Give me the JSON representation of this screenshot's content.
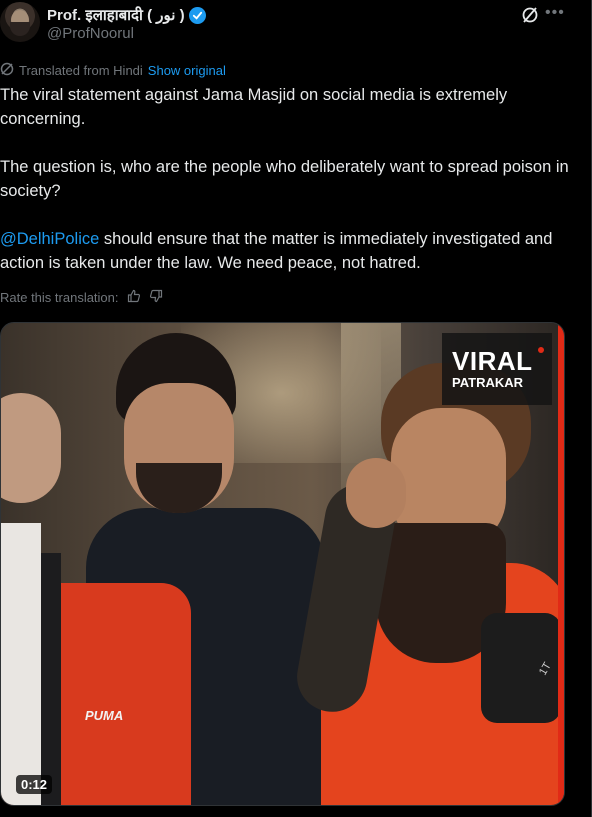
{
  "author": {
    "display_name": "Prof. इलाहाबादी ( نور )",
    "handle": "@ProfNoorul"
  },
  "translation": {
    "label": "Translated from Hindi",
    "show_original": "Show original",
    "rate_label": "Rate this translation:"
  },
  "tweet": {
    "para1": "The viral statement against Jama Masjid on social media is extremely concerning.",
    "para2": "The question is, who are the people who deliberately want to spread poison in society?",
    "mention": "@DelhiPolice",
    "para3_rest": " should ensure that the matter is immediately investigated and action is taken under the law. We need peace, not hatred."
  },
  "video": {
    "logo_line1": "VIRAL",
    "logo_line2": "PATRAKAR",
    "duration": "0:12",
    "jacket_text": "PUMA",
    "mic_text": "1T"
  },
  "colors": {
    "accent": "#1d9bf0",
    "muted": "#71767b",
    "text": "#e7e9ea",
    "background": "#000000"
  },
  "icons": [
    "verified-badge-icon",
    "grok-icon",
    "more-icon",
    "translate-icon",
    "thumbs-up-icon",
    "thumbs-down-icon"
  ]
}
